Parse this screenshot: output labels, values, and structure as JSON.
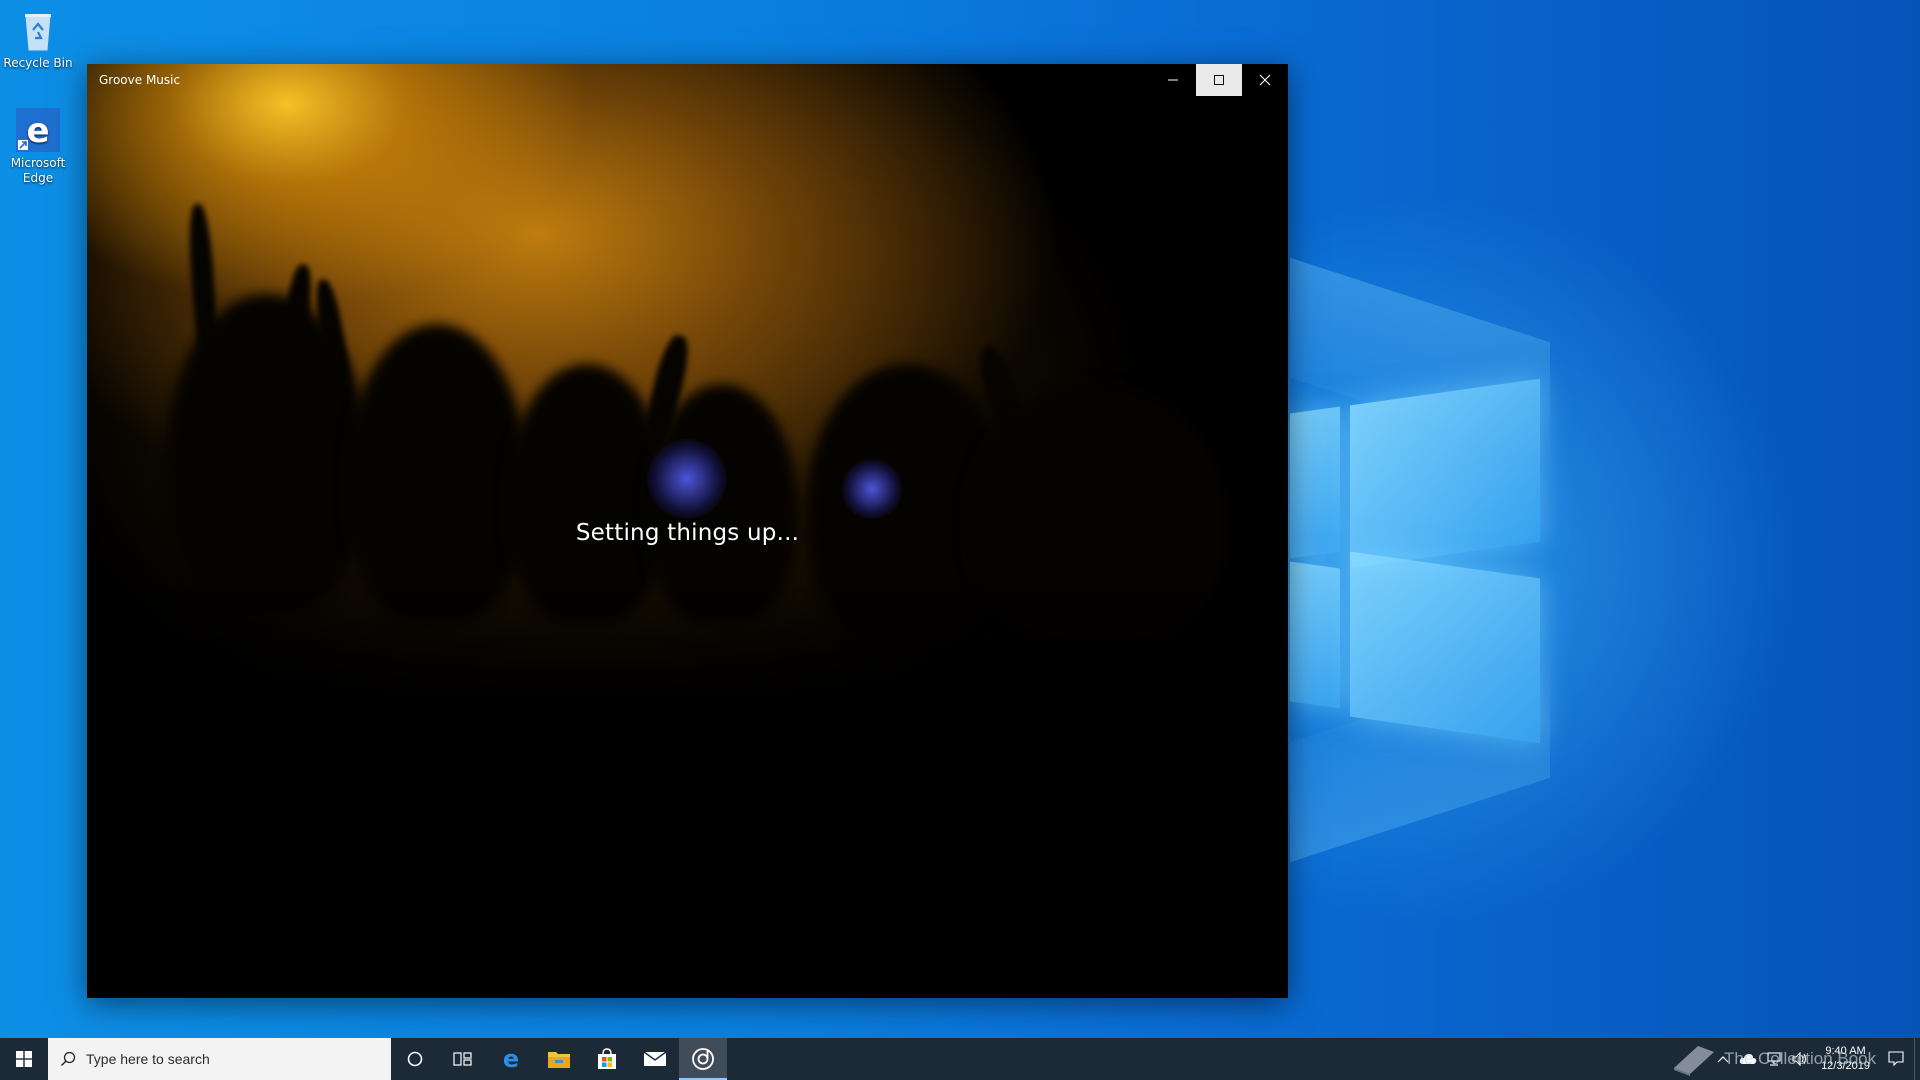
{
  "desktop": {
    "icons": [
      {
        "label": "Recycle Bin",
        "icon": "recycle-bin-icon"
      },
      {
        "label": "Microsoft Edge",
        "icon": "edge-icon"
      }
    ]
  },
  "window": {
    "title": "Groove Music",
    "status": "Setting things up...",
    "buttons": {
      "minimize": "minimize-icon",
      "maximize": "maximize-icon",
      "close": "close-icon"
    }
  },
  "taskbar": {
    "search_placeholder": "Type here to search",
    "apps": [
      "cortana-icon",
      "task-view-icon",
      "edge-icon",
      "file-explorer-icon",
      "store-icon",
      "mail-icon",
      "groove-music-icon"
    ],
    "clock": {
      "time": "9:40 AM",
      "date": "12/3/2019"
    }
  },
  "watermark": "The Collection Book",
  "colors": {
    "taskbar": "#1c2a38",
    "desktop_blue": "#0a7fe0",
    "accent": "#0078d7"
  }
}
